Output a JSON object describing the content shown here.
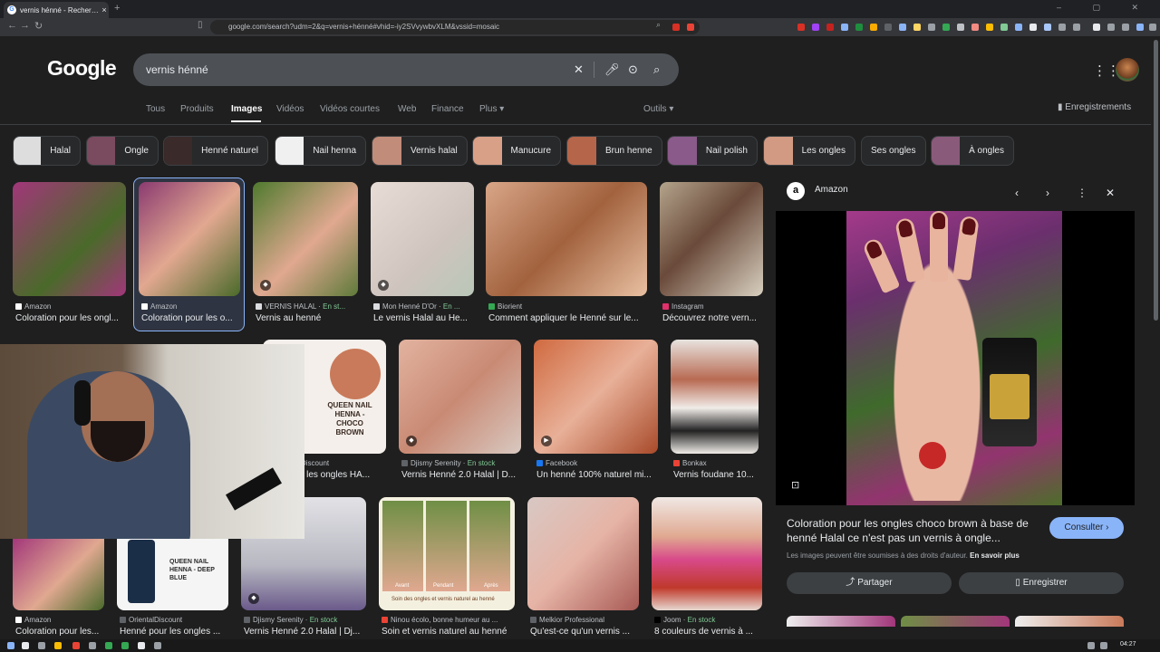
{
  "browser": {
    "tab_title": "vernis hénné - Recherche Googl",
    "tab_close": "×",
    "new_tab": "+",
    "url": "google.com/search?udm=2&q=vernis+hénné#vhid=-iy2SVvywbvXLM&vssid=mosaic",
    "window_controls": "– ▢ ✕"
  },
  "google": {
    "logo": "Google",
    "query": "vernis hénné",
    "tabs": [
      "Tous",
      "Produits",
      "Images",
      "Vidéos",
      "Vidéos courtes",
      "Web",
      "Finance",
      "Plus ▾"
    ],
    "active_tab": "Images",
    "tools": "Outils ▾",
    "saved": "Enregistrements"
  },
  "chips": [
    "Halal",
    "Ongle",
    "Henné naturel",
    "Nail henna",
    "Vernis halal",
    "Manucure",
    "Brun henne",
    "Nail polish",
    "Les ongles",
    "Ses ongles",
    "À ongles"
  ],
  "results": [
    {
      "source": "Amazon",
      "caption": "Coloration pour les ongl...",
      "color": "#7a3b6a"
    },
    {
      "source": "Amazon",
      "caption": "Coloration pour les o...",
      "color": "#8a3a70"
    },
    {
      "source": "VERNIS HALAL",
      "stock": "En st...",
      "caption": "Vernis au henné",
      "color": "#5e7a3a"
    },
    {
      "source": "Mon Henné D'Or",
      "stock": "En ...",
      "caption": "Le vernis Halal au He...",
      "color": "#d8d0cc"
    },
    {
      "source": "Biorient",
      "caption": "Comment appliquer le Henné sur le...",
      "color": "#b07a55"
    },
    {
      "source": "Instagram",
      "caption": "Découvrez notre vern...",
      "color": "#9c8f7a"
    },
    {
      "source": "Discount",
      "caption": "r les ongles HA...",
      "color": "#f2ece8"
    },
    {
      "source": "Djismy Serenity",
      "stock": "En stock",
      "caption": "Vernis Henné 2.0 Halal | D...",
      "color": "#c98a74"
    },
    {
      "source": "Facebook",
      "caption": "Un henné 100% naturel mi...",
      "color": "#c45f3a"
    },
    {
      "source": "Bonkax",
      "caption": "Vernis foudane 10...",
      "color": "#e7e3df"
    },
    {
      "source": "Amazon",
      "caption": "Coloration pour les...",
      "color": "#7a3b6a"
    },
    {
      "source": "OrientalDiscount",
      "caption": "Henné pour les ongles ...",
      "color": "#f0f0f0"
    },
    {
      "source": "Djismy Serenity",
      "stock": "En stock",
      "caption": "Vernis Henné 2.0 Halal | Dj...",
      "color": "#c8c8cc"
    },
    {
      "source": "Ninou écolo, bonne humeur au ...",
      "caption": "Soin et vernis naturel au henné",
      "color": "#6f8f45"
    },
    {
      "source": "Melkior Professional",
      "caption": "Qu'est-ce qu'un vernis ...",
      "color": "#a85a55"
    },
    {
      "source": "Joom",
      "stock": "En stock",
      "caption": "8 couleurs de vernis à ...",
      "color": "#e6d8d0"
    }
  ],
  "overlay_texts": {
    "queen_choco": "QUEEN NAIL HENNA - CHOCO BROWN",
    "queen_blue": "QUEEN NAIL HENNA - DEEP BLUE",
    "avant": "Avant",
    "pendant": "Pendant",
    "apres": "Après",
    "soin_caption": "Soin des ongles et vernis naturel au henné"
  },
  "panel": {
    "source": "Amazon",
    "title": "Coloration pour les ongles choco brown à base de henné Halal ce n'est pas un vernis à ongle...",
    "consult": "Consulter ›",
    "notice": "Les images peuvent être soumises à des droits d'auteur.",
    "learn_more": "En savoir plus",
    "share": "Partager",
    "save": "Enregistrer"
  },
  "taskbar": {
    "time": "04:27"
  }
}
